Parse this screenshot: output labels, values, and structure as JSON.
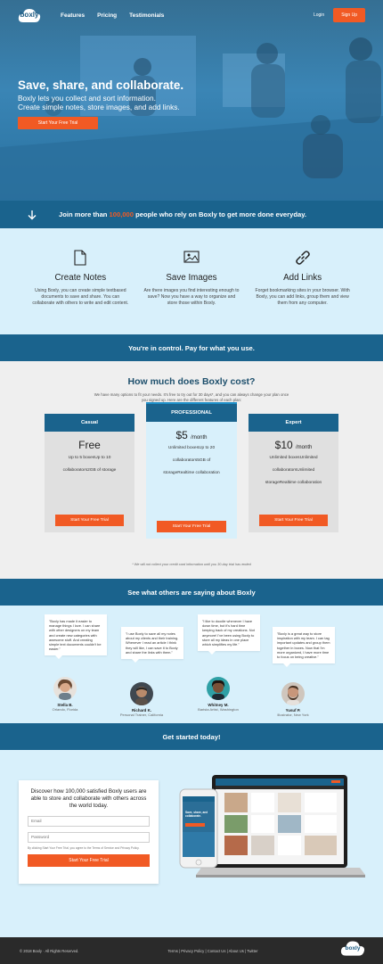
{
  "nav": {
    "logo": "boxly",
    "links": [
      "Features",
      "Pricing",
      "Testimonials"
    ],
    "login": "Login",
    "signup": "Sign Up"
  },
  "hero": {
    "title": "Save, share, and collaborate.",
    "subtitle_1": "Boxly lets you collect and sort information.",
    "subtitle_2": "Create simple notes, store images, and add links.",
    "cta": "Start Your Free Trial"
  },
  "join": {
    "before": "Join more than ",
    "number": "100,000",
    "after": " people who rely on Boxly to get more done everyday."
  },
  "features": [
    {
      "icon": "document-icon",
      "title": "Create Notes",
      "desc": "Using Boxly, you can create simple textbased documents to save and share. You can collaborate with others to write and edit content."
    },
    {
      "icon": "image-icon",
      "title": "Save Images",
      "desc": "Are there images you find interesting enough to save? Now you have a way to organize and store those within Boxly."
    },
    {
      "icon": "link-icon",
      "title": "Add Links",
      "desc": "Forget bookmarking sites in your browser. With Boxly, you can add links, group them and view them from any computer."
    }
  ],
  "control_banner": "You're in control. Pay for what you use.",
  "pricing": {
    "title": "How much does Boxly cost?",
    "subtitle": "We have many options to fit your needs. It's free to try out for 30 days*, and you can always change your plan once you signed up. Here are the different features of each plan:",
    "plans": [
      {
        "name": "Casual",
        "price": "Free",
        "per": "",
        "features": [
          "Up to 5 boxesUp to 10",
          "collaborators2GB of storage"
        ],
        "cta": "Start Your Free Trial"
      },
      {
        "name": "PROFESSIONAL",
        "price": "$5",
        "per": "/month",
        "features": [
          "Unlimited boxesUp to 20",
          "collaborators5GB of",
          "storageRealtime collaboration"
        ],
        "cta": "Start Your Free Trial"
      },
      {
        "name": "Expert",
        "price": "$10",
        "per": "/month",
        "features": [
          "Unlimited boxesUnlimited",
          "collaboratorsUnlimited",
          "storageRealtime collaboration"
        ],
        "cta": "Start Your Free Trial"
      }
    ],
    "note": "* We will not collect your credit card information until you 30-day trial has ended"
  },
  "testimonials": {
    "banner": "See what others are saying about Boxly",
    "items": [
      {
        "quote": "\"Boxly has made it easier to manage things I love. I can share with other designers on my team and create new categories with awesome stuff. And creating simple text documents couldn't be easier.\"",
        "name": "Stella B.",
        "location": "Orlando, Florida"
      },
      {
        "quote": "\"I use Boxly to save all my notes about my clients and their training. Whenever I read an article I think they will like, I can save it to Boxly and share the links with them.\"",
        "name": "Richard K.",
        "location": "Personal Trainer, California"
      },
      {
        "quote": "\"I like to doodle whenever I have down time, but it's hard time keeping track of my creations. Not anymore! I've been using Boxly to store all my ideas in one place which simplifies my life.\"",
        "name": "Whitney M.",
        "location": "Barista Artist, Washington"
      },
      {
        "quote": "\"Boxly is a great way to store inspiration with my team. I can tag important updates and group them together in boxes. Now that I'm more organized, I have more time to focus on being creative.\"",
        "name": "Yusuf P.",
        "location": "Illustrator, New York"
      }
    ]
  },
  "get_started": {
    "banner": "Get started today!",
    "form_title": "Discover how 100,000 satisfied Boxly users are able to store and collaborate with others across the world today.",
    "email_placeholder": "Email",
    "password_placeholder": "Password",
    "terms": "By clicking Start Your Free Trial, you agree to the Terms of Service and Privacy Policy.",
    "cta": "Start Your Free Trial",
    "phone_text": "Save, share, and collaborate."
  },
  "footer": {
    "copyright": "© 2018 Boxly · All Rights Reserved.",
    "links": "Terms  |  Privacy Policy  |  Contact Us  |  About Us  |  Twitter",
    "logo": "boxly"
  },
  "colors": {
    "primary": "#1a638d",
    "accent": "#f15a24",
    "light": "#d8f0fb"
  }
}
